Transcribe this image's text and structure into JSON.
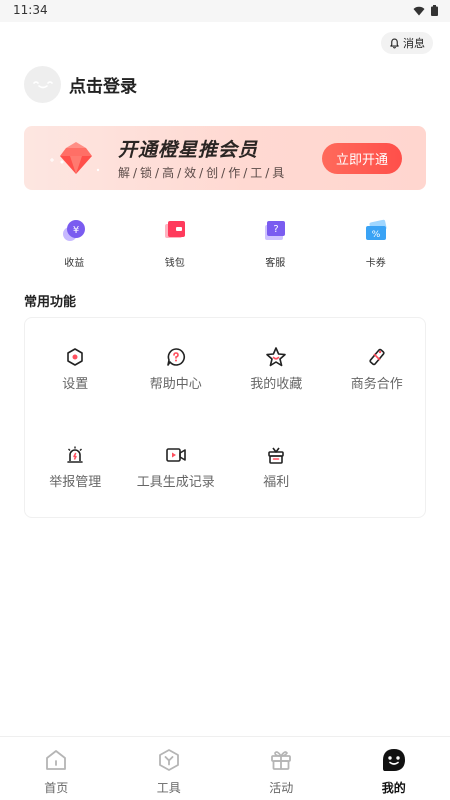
{
  "status_bar": {
    "time": "11:34"
  },
  "header": {
    "message_label": "消息"
  },
  "profile": {
    "login_label": "点击登录"
  },
  "vip_banner": {
    "title": "开通橙星推会员",
    "subtitle": "解/锁/高/效/创/作/工/具",
    "button_label": "立即开通"
  },
  "quick_links": [
    {
      "label": "收益",
      "icon": "earnings-icon"
    },
    {
      "label": "钱包",
      "icon": "wallet-icon"
    },
    {
      "label": "客服",
      "icon": "customer-service-icon"
    },
    {
      "label": "卡券",
      "icon": "coupon-icon"
    }
  ],
  "common_functions": {
    "title": "常用功能",
    "items": [
      {
        "label": "设置",
        "icon": "settings-icon"
      },
      {
        "label": "帮助中心",
        "icon": "help-icon"
      },
      {
        "label": "我的收藏",
        "icon": "star-icon"
      },
      {
        "label": "商务合作",
        "icon": "handshake-icon"
      },
      {
        "label": "举报管理",
        "icon": "alarm-icon"
      },
      {
        "label": "工具生成记录",
        "icon": "video-record-icon"
      },
      {
        "label": "福利",
        "icon": "gift-icon"
      }
    ]
  },
  "tabbar": {
    "active": "我的",
    "tabs": [
      {
        "label": "首页",
        "icon": "home-icon"
      },
      {
        "label": "工具",
        "icon": "tools-icon"
      },
      {
        "label": "活动",
        "icon": "gift-icon"
      },
      {
        "label": "我的",
        "icon": "profile-icon"
      }
    ]
  },
  "colors": {
    "accent": "#ff5a4e",
    "banner_bg": "#fddcd5",
    "text_primary": "#222222",
    "text_secondary": "#666666"
  }
}
